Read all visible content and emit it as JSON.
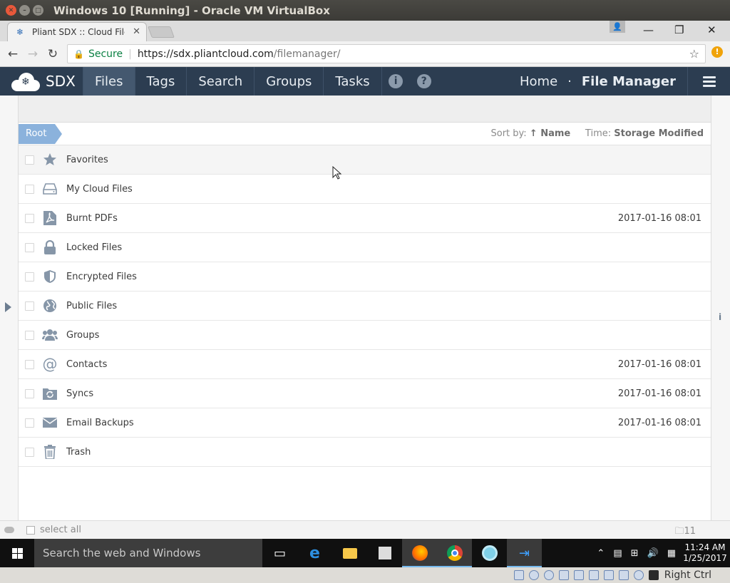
{
  "vbox": {
    "title": "Windows 10 [Running] - Oracle VM VirtualBox",
    "status_right": "Right Ctrl"
  },
  "browser": {
    "tab_title": "Pliant SDX :: Cloud File M",
    "secure_label": "Secure",
    "url_host": "https://sdx.pliantcloud.com",
    "url_path": "/filemanager/"
  },
  "app": {
    "brand": "SDX",
    "nav": [
      "Files",
      "Tags",
      "Search",
      "Groups",
      "Tasks"
    ],
    "active_nav": "Files",
    "crumb_home": "Home",
    "crumb_sep": "·",
    "crumb_current": "File Manager"
  },
  "filemanager": {
    "root_label": "Root",
    "sort_label": "Sort by:",
    "sort_value": "↑ Name",
    "time_label": "Time:",
    "time_value": "Storage Modified",
    "items": [
      {
        "name": "Favorites",
        "icon": "star-icon",
        "date": ""
      },
      {
        "name": "My Cloud Files",
        "icon": "drive-icon",
        "date": ""
      },
      {
        "name": "Burnt PDFs",
        "icon": "pdf-icon",
        "date": "2017-01-16 08:01"
      },
      {
        "name": "Locked Files",
        "icon": "lock-icon",
        "date": ""
      },
      {
        "name": "Encrypted Files",
        "icon": "shield-icon",
        "date": ""
      },
      {
        "name": "Public Files",
        "icon": "globe-icon",
        "date": ""
      },
      {
        "name": "Groups",
        "icon": "users-icon",
        "date": ""
      },
      {
        "name": "Contacts",
        "icon": "at-icon",
        "date": "2017-01-16 08:01"
      },
      {
        "name": "Syncs",
        "icon": "sync-folder-icon",
        "date": "2017-01-16 08:01"
      },
      {
        "name": "Email Backups",
        "icon": "envelope-icon",
        "date": "2017-01-16 08:01"
      },
      {
        "name": "Trash",
        "icon": "trash-icon",
        "date": ""
      }
    ],
    "select_all": "select all",
    "count": "11"
  },
  "taskbar": {
    "search_placeholder": "Search the web and Windows",
    "time": "11:24 AM",
    "date": "1/25/2017"
  }
}
